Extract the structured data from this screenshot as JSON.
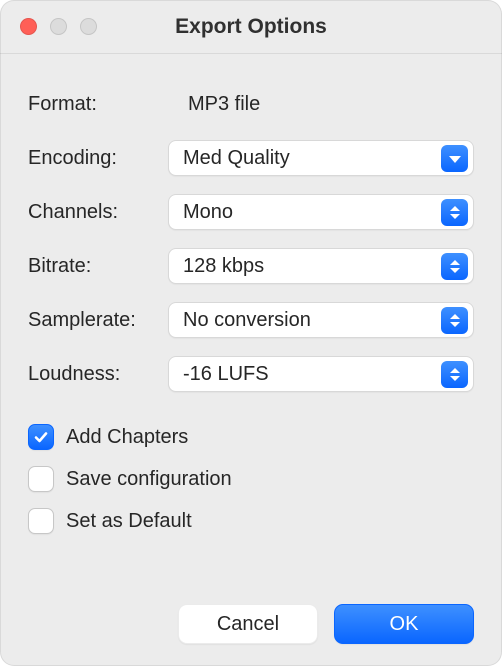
{
  "window": {
    "title": "Export Options"
  },
  "form": {
    "format_label": "Format:",
    "format_value": "MP3 file",
    "encoding_label": "Encoding:",
    "encoding_value": "Med Quality",
    "channels_label": "Channels:",
    "channels_value": "Mono",
    "bitrate_label": "Bitrate:",
    "bitrate_value": "128 kbps",
    "samplerate_label": "Samplerate:",
    "samplerate_value": "No conversion",
    "loudness_label": "Loudness:",
    "loudness_value": "-16 LUFS"
  },
  "checks": {
    "add_chapters": {
      "label": "Add Chapters",
      "checked": true
    },
    "save_config": {
      "label": "Save configuration",
      "checked": false
    },
    "set_default": {
      "label": "Set as Default",
      "checked": false
    }
  },
  "buttons": {
    "cancel": "Cancel",
    "ok": "OK"
  }
}
